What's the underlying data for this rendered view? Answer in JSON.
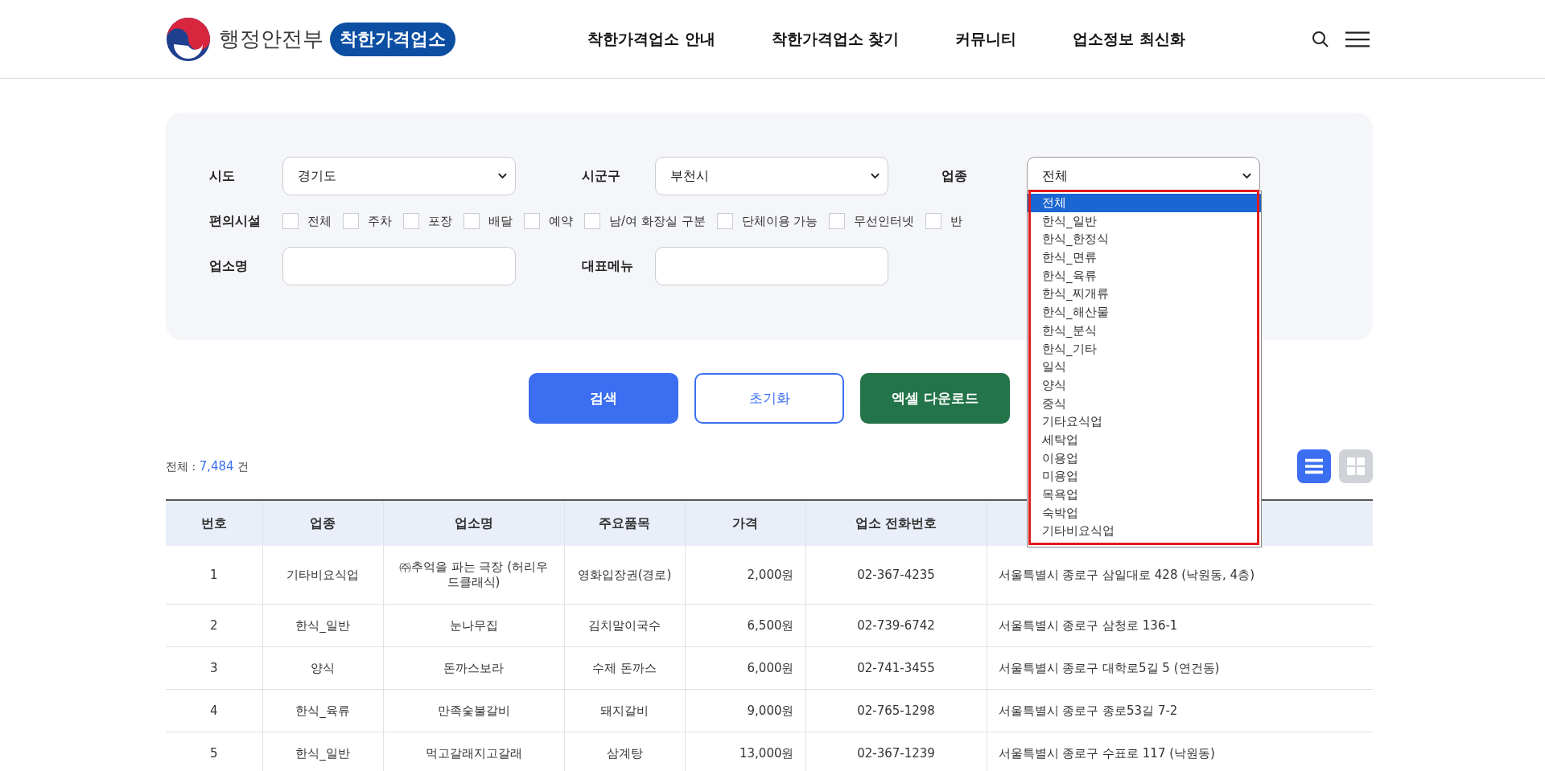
{
  "header": {
    "logo_text": "행정안전부",
    "badge": "착한가격업소",
    "nav": [
      "착한가격업소 안내",
      "착한가격업소 찾기",
      "커뮤니티",
      "업소정보 최신화"
    ]
  },
  "filters": {
    "selects": [
      {
        "label": "시도",
        "value": "경기도",
        "expanded": false
      },
      {
        "label": "시군구",
        "value": "부천시",
        "expanded": false
      },
      {
        "label": "업종",
        "value": "전체",
        "expanded": true,
        "options": [
          {
            "label": "전체",
            "selected": true
          },
          {
            "label": "한식_일반",
            "selected": false
          },
          {
            "label": "한식_한정식",
            "selected": false
          },
          {
            "label": "한식_면류",
            "selected": false
          },
          {
            "label": "한식_육류",
            "selected": false
          },
          {
            "label": "한식_찌개류",
            "selected": false
          },
          {
            "label": "한식_해산물",
            "selected": false
          },
          {
            "label": "한식_분식",
            "selected": false
          },
          {
            "label": "한식_기타",
            "selected": false
          },
          {
            "label": "일식",
            "selected": false
          },
          {
            "label": "양식",
            "selected": false
          },
          {
            "label": "중식",
            "selected": false
          },
          {
            "label": "기타요식업",
            "selected": false
          },
          {
            "label": "세탁업",
            "selected": false
          },
          {
            "label": "이용업",
            "selected": false
          },
          {
            "label": "미용업",
            "selected": false
          },
          {
            "label": "목욕업",
            "selected": false
          },
          {
            "label": "숙박업",
            "selected": false
          },
          {
            "label": "기타비요식업",
            "selected": false
          }
        ]
      }
    ],
    "amenities_label": "편의시설",
    "amenities": [
      {
        "label": "전체",
        "checked": false
      },
      {
        "label": "주차",
        "checked": false
      },
      {
        "label": "포장",
        "checked": false
      },
      {
        "label": "배달",
        "checked": false
      },
      {
        "label": "예약",
        "checked": false
      },
      {
        "label": "남/여 화장실 구분",
        "checked": false
      },
      {
        "label": "단체이용 가능",
        "checked": false
      },
      {
        "label": "무선인터넷",
        "checked": false
      },
      {
        "label": "반",
        "checked": false
      }
    ],
    "text_fields": [
      {
        "label": "업소명"
      },
      {
        "label": "대표메뉴"
      }
    ]
  },
  "buttons": [
    {
      "label": "검색",
      "kind": "primary"
    },
    {
      "label": "초기화",
      "kind": "outline"
    },
    {
      "label": "엑셀 다운로드",
      "kind": "excel"
    }
  ],
  "count": {
    "prefix": "전체 :",
    "value": "7,484",
    "suffix": "건"
  },
  "view_toggle": [
    {
      "kind": "list",
      "selected": true
    },
    {
      "kind": "grid",
      "selected": false
    }
  ],
  "table": {
    "columns": [
      "번호",
      "업종",
      "업소명",
      "주요품목",
      "가격",
      "업소 전화번호",
      ""
    ],
    "rows": [
      [
        "1",
        "기타비요식업",
        "㈜추억을 파는 극장 (허리우드클래식)",
        "영화입장권(경로)",
        "2,000원",
        "02-367-4235",
        "서울특별시 종로구 삼일대로 428 (낙원동, 4층)"
      ],
      [
        "2",
        "한식_일반",
        "눈나무집",
        "김치말이국수",
        "6,500원",
        "02-739-6742",
        "서울특별시 종로구 삼청로 136-1"
      ],
      [
        "3",
        "양식",
        "돈까스보라",
        "수제 돈까스",
        "6,000원",
        "02-741-3455",
        "서울특별시 종로구 대학로5길 5 (연건동)"
      ],
      [
        "4",
        "한식_육류",
        "만족숯불갈비",
        "돼지갈비",
        "9,000원",
        "02-765-1298",
        "서울특별시 종로구 종로53길 7-2"
      ],
      [
        "5",
        "한식_일반",
        "먹고갈래지고갈래",
        "삼계탕",
        "13,000원",
        "02-367-1239",
        "서울특별시 종로구 수표로 117 (낙원동)"
      ]
    ]
  }
}
